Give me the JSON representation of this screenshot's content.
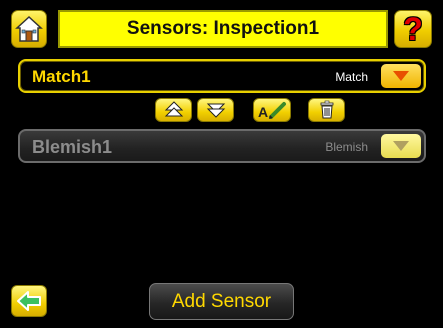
{
  "header": {
    "title": "Sensors: Inspection1",
    "home_icon": "home-icon",
    "help_label": "?"
  },
  "sensors": [
    {
      "name": "Match1",
      "type": "Match",
      "state": "active"
    },
    {
      "name": "Blemish1",
      "type": "Blemish",
      "state": "inactive"
    }
  ],
  "actions": {
    "icons": [
      "move-up-icon",
      "move-down-icon",
      "rename-icon",
      "delete-icon"
    ],
    "rename_label": "A"
  },
  "footer": {
    "back_icon": "back-arrow-icon",
    "add_sensor_label": "Add Sensor"
  },
  "colors": {
    "accent": "#ffd800",
    "title_bg": "#ffff00",
    "help_mark": "#e00000",
    "dropdown_arrow": "#e85000"
  }
}
